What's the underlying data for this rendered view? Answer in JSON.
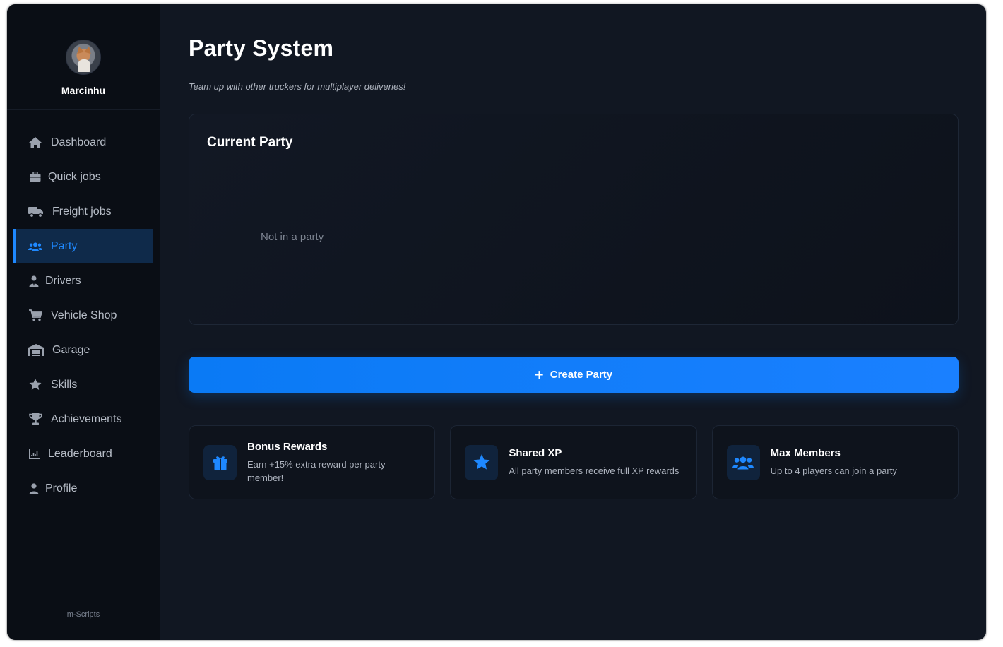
{
  "user": {
    "name": "Marcinhu"
  },
  "sidebar": {
    "items": [
      {
        "label": "Dashboard",
        "icon": "home-icon"
      },
      {
        "label": "Quick jobs",
        "icon": "briefcase-icon"
      },
      {
        "label": "Freight jobs",
        "icon": "truck-icon"
      },
      {
        "label": "Party",
        "icon": "users-icon",
        "active": true
      },
      {
        "label": "Drivers",
        "icon": "user-tie-icon"
      },
      {
        "label": "Vehicle Shop",
        "icon": "cart-icon"
      },
      {
        "label": "Garage",
        "icon": "warehouse-icon"
      },
      {
        "label": "Skills",
        "icon": "star-icon"
      },
      {
        "label": "Achievements",
        "icon": "trophy-icon"
      },
      {
        "label": "Leaderboard",
        "icon": "chart-line-icon"
      },
      {
        "label": "Profile",
        "icon": "user-icon"
      }
    ],
    "footer": "m-Scripts"
  },
  "main": {
    "title": "Party System",
    "subtitle": "Team up with other truckers for multiplayer deliveries!",
    "party_panel": {
      "title": "Current Party",
      "empty_text": "Not in a party"
    },
    "create_button": "Create Party",
    "features": [
      {
        "title": "Bonus Rewards",
        "description": "Earn +15% extra reward per party member!",
        "icon": "gift-icon"
      },
      {
        "title": "Shared XP",
        "description": "All party members receive full XP rewards",
        "icon": "star-icon"
      },
      {
        "title": "Max Members",
        "description": "Up to 4 players can join a party",
        "icon": "users-icon"
      }
    ]
  },
  "colors": {
    "accent": "#1e88ff",
    "background": "#111722",
    "sidebar": "#0a0e15"
  }
}
